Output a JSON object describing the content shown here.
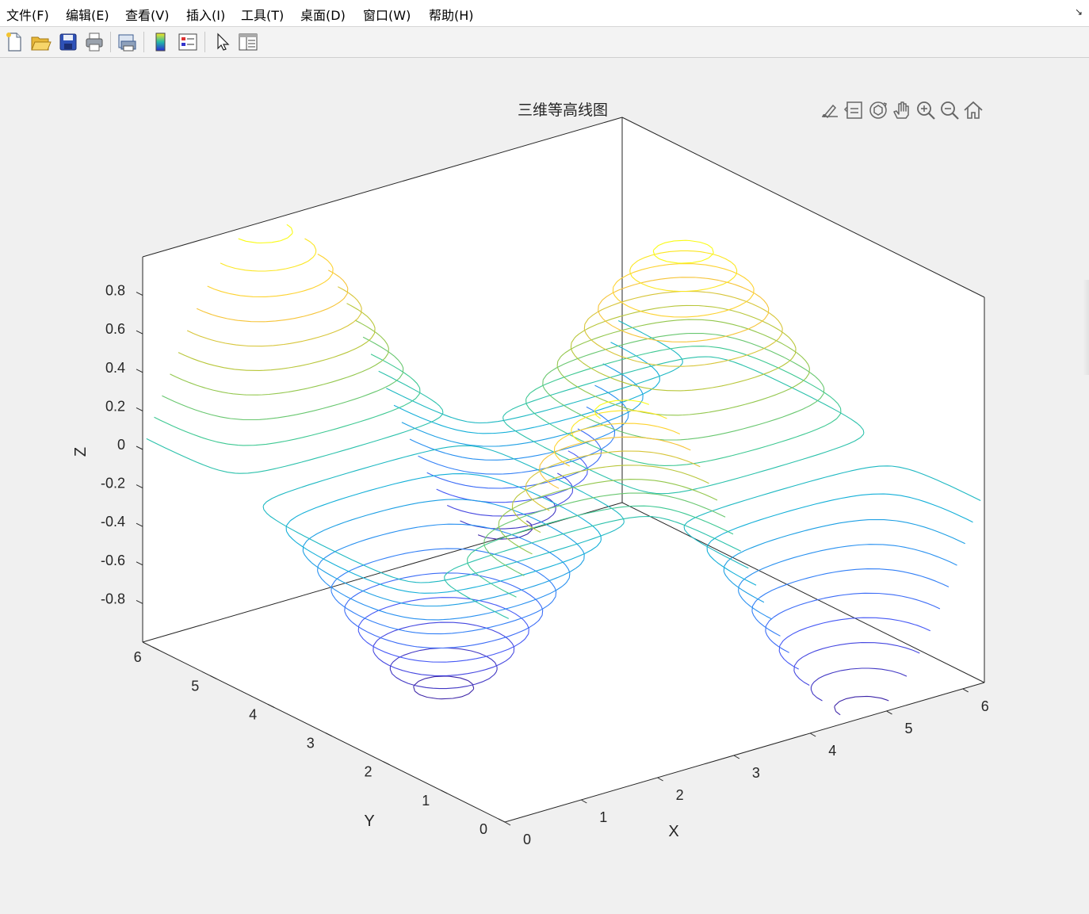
{
  "menu": {
    "file": "文件(F)",
    "edit": "编辑(E)",
    "view": "查看(V)",
    "insert": "插入(I)",
    "tools": "工具(T)",
    "desktop": "桌面(D)",
    "window": "窗口(W)",
    "help": "帮助(H)"
  },
  "toolbar": {
    "buttons": [
      "new-figure-icon",
      "open-icon",
      "save-icon",
      "print-icon",
      "print-preview-icon",
      "colorbar-icon",
      "legend-icon",
      "pointer-icon",
      "property-inspector-icon"
    ]
  },
  "axes_toolbar": {
    "buttons": [
      "brush-icon",
      "data-tips-icon",
      "rotate-3d-icon",
      "pan-icon",
      "zoom-in-icon",
      "zoom-out-icon",
      "home-icon"
    ]
  },
  "colors": {
    "contour_low": "#1f1fd0",
    "contour_mid": "#1cb1b1",
    "contour_high": "#f6e823"
  },
  "chart_data": {
    "type": "contour3",
    "title": "三维等高线图",
    "xlabel": "X",
    "ylabel": "Y",
    "zlabel": "Z",
    "xlim": [
      0,
      6.283
    ],
    "ylim": [
      0,
      6.283
    ],
    "zlim": [
      -1,
      1
    ],
    "xticks": [
      "0",
      "1",
      "2",
      "3",
      "4",
      "5",
      "6"
    ],
    "yticks": [
      "0",
      "1",
      "2",
      "3",
      "4",
      "5",
      "6"
    ],
    "zticks": [
      "-0.8",
      "-0.6",
      "-0.4",
      "-0.2",
      "0",
      "0.2",
      "0.4",
      "0.6",
      "0.8"
    ],
    "grid": true,
    "colormap": "parula",
    "function": "z = sin(x)·cos(y)",
    "levels": [
      -0.95,
      -0.85,
      -0.75,
      -0.65,
      -0.55,
      -0.45,
      -0.35,
      -0.25,
      -0.15,
      -0.05,
      0.05,
      0.15,
      0.25,
      0.35,
      0.45,
      0.55,
      0.65,
      0.75,
      0.85,
      0.95
    ]
  }
}
